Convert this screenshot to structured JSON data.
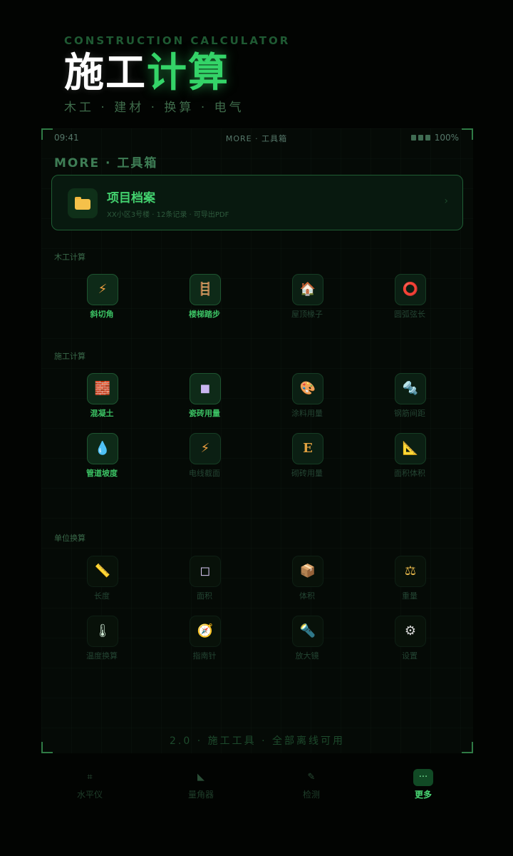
{
  "hero": {
    "subtitle": "CONSTRUCTION CALCULATOR",
    "title_white": "施工",
    "title_green": "计算",
    "tagline": "木工 · 建材 · 换算 · 电气"
  },
  "status_bar": {
    "time": "09:41",
    "center": "MORE · 工具箱",
    "battery": "100%"
  },
  "page_title": "MORE · 工具箱",
  "project_card": {
    "title": "项目档案",
    "subtitle": "XX小区3号楼 · 12条记录 · 可导出PDF",
    "arrow": "›"
  },
  "sections": {
    "woodwork": {
      "title": "木工计算",
      "items": [
        {
          "label": "斜切角",
          "icon": "⚡",
          "icon_name": "lightning-icon"
        },
        {
          "label": "楼梯踏步",
          "icon": "🪜",
          "icon_name": "ladder-icon"
        },
        {
          "label": "屋顶椽子",
          "icon": "🏠",
          "icon_name": "house-icon"
        },
        {
          "label": "圆弧弦长",
          "icon": "⭕",
          "icon_name": "circle-icon"
        }
      ]
    },
    "construction": {
      "title": "施工计算",
      "items": [
        {
          "label": "混凝土",
          "icon": "🧱",
          "icon_name": "brick-icon"
        },
        {
          "label": "瓷砖用量",
          "icon": "◼",
          "icon_name": "tile-square-icon"
        },
        {
          "label": "涂料用量",
          "icon": "🎨",
          "icon_name": "palette-icon"
        },
        {
          "label": "钢筋间距",
          "icon": "🔩",
          "icon_name": "rebar-icon"
        },
        {
          "label": "管道坡度",
          "icon": "💧",
          "icon_name": "droplet-icon"
        },
        {
          "label": "电线截面",
          "icon": "⚡",
          "icon_name": "lightning-icon"
        },
        {
          "label": "砌砖用量",
          "icon": "E",
          "icon_name": "brick-e-icon"
        },
        {
          "label": "面积体积",
          "icon": "📐",
          "icon_name": "triangle-ruler-icon"
        }
      ]
    },
    "units": {
      "title": "单位换算",
      "items": [
        {
          "label": "长度",
          "icon": "📏",
          "icon_name": "ruler-icon"
        },
        {
          "label": "面积",
          "icon": "◻",
          "icon_name": "area-square-icon"
        },
        {
          "label": "体积",
          "icon": "📦",
          "icon_name": "box-icon"
        },
        {
          "label": "重量",
          "icon": "⚖",
          "icon_name": "scale-icon"
        },
        {
          "label": "温度换算",
          "icon": "🌡",
          "icon_name": "thermometer-icon"
        },
        {
          "label": "指南针",
          "icon": "🧭",
          "icon_name": "compass-icon"
        },
        {
          "label": "放大镜",
          "icon": "🔦",
          "icon_name": "flashlight-icon"
        },
        {
          "label": "设置",
          "icon": "⚙",
          "icon_name": "gear-icon"
        }
      ]
    }
  },
  "footer": "2.0 · 施工工具 · 全部离线可用",
  "tabbar": [
    {
      "label": "水平仪",
      "icon": "⌗"
    },
    {
      "label": "量角器",
      "icon": "◣"
    },
    {
      "label": "检测",
      "icon": "✎"
    },
    {
      "label": "更多",
      "icon": "···"
    }
  ],
  "colors": {
    "accent_green": "#34d468",
    "background": "#020402",
    "card_border": "#1f5e34"
  }
}
